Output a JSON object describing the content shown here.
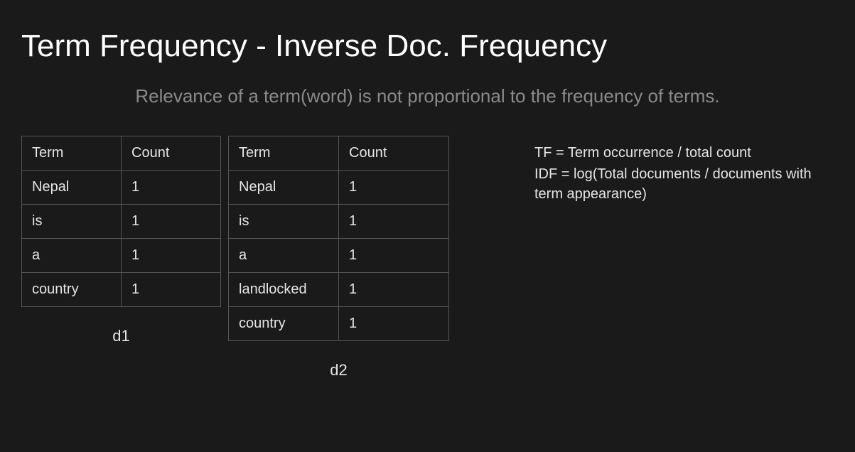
{
  "title": "Term Frequency - Inverse Doc. Frequency",
  "subtitle": "Relevance of a term(word) is not proportional to the frequency of terms.",
  "tables": {
    "t1": {
      "label": "d1",
      "header": {
        "term": "Term",
        "count": "Count"
      },
      "rows": [
        {
          "term": "Nepal",
          "count": "1"
        },
        {
          "term": "is",
          "count": "1"
        },
        {
          "term": "a",
          "count": "1"
        },
        {
          "term": "country",
          "count": "1"
        }
      ]
    },
    "t2": {
      "label": "d2",
      "header": {
        "term": "Term",
        "count": "Count"
      },
      "rows": [
        {
          "term": "Nepal",
          "count": "1"
        },
        {
          "term": "is",
          "count": "1"
        },
        {
          "term": "a",
          "count": "1"
        },
        {
          "term": "landlocked",
          "count": "1"
        },
        {
          "term": "country",
          "count": "1"
        }
      ]
    }
  },
  "formulas": {
    "tf": "TF =  Term occurrence / total count",
    "idf": "IDF = log(Total documents / documents with term appearance)"
  }
}
